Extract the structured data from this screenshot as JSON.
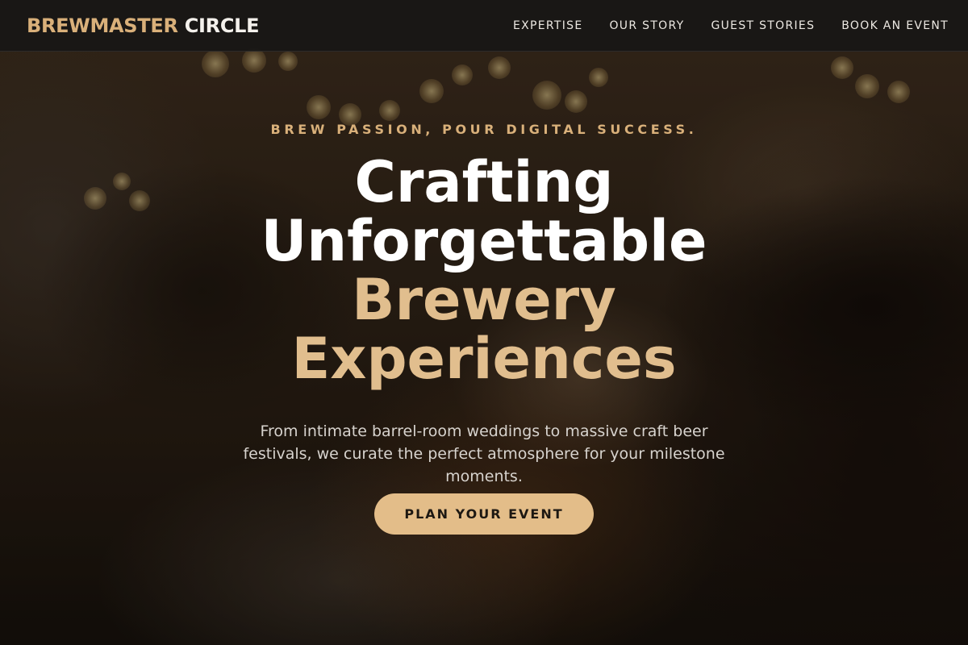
{
  "navbar": {
    "logo_accent": "BREWMASTER",
    "logo_rest": "CIRCLE",
    "links": [
      {
        "label": "EXPERTISE"
      },
      {
        "label": "OUR STORY"
      },
      {
        "label": "GUEST STORIES"
      },
      {
        "label": "BOOK AN EVENT"
      }
    ]
  },
  "hero": {
    "tagline": "BREW PASSION, POUR DIGITAL SUCCESS.",
    "headline": {
      "line1": "Crafting",
      "line2": "Unforgettable",
      "line3": "Brewery",
      "line4": "Experiences"
    },
    "description": "From intimate barrel-room weddings to massive craft beer festivals, we curate the perfect atmosphere for your milestone moments.",
    "cta_label": "PLAN YOUR EVENT"
  },
  "colors": {
    "accent_gold": "#d9b07a",
    "button_fill": "#e3bd89",
    "navbar_bg": "#181715",
    "headline_white": "#ffffff"
  }
}
